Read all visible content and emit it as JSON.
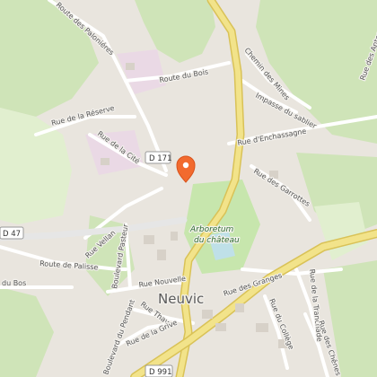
{
  "map": {
    "town": "Neuvic",
    "park": {
      "line1": "Arboretum",
      "line2": "du château"
    },
    "shields": {
      "d171": "D 171",
      "d47": "D 47",
      "d991": "D 991"
    },
    "streets": {
      "palonieres": "Route des Paloniéres",
      "bois": "Route du Bois",
      "reserve": "Rue de la Réserve",
      "cite": "Rue de la Cité",
      "vellan": "Rue Vellan",
      "pasteur": "Boulevard Pasteur",
      "nouvelle": "Rue Nouvelle",
      "palisse": "Route de Palisse",
      "dubos": "du Bos",
      "thave": "Rue Thave",
      "grive": "Rue de la Grive",
      "pendant": "Boulevard du Pendant",
      "granges": "Rue des Granges",
      "college": "Rue du Collège",
      "tranchade": "Rue de la Tranchade",
      "chenes": "Rue des Chênes",
      "garrottes": "Rue des Garrottes",
      "enchassagne": "Rue d'Enchassagne",
      "sablier": "Impasse du sablier",
      "mines": "Chemin des Mines",
      "antes": "Rue des Antes"
    },
    "marker": {
      "type": "place-pin",
      "color": "#f26a2e"
    },
    "colors": {
      "forest": "#cfe4b8",
      "park": "#c7e6ad",
      "highway": "#f2e38a",
      "water": "#bfe0e8"
    }
  }
}
